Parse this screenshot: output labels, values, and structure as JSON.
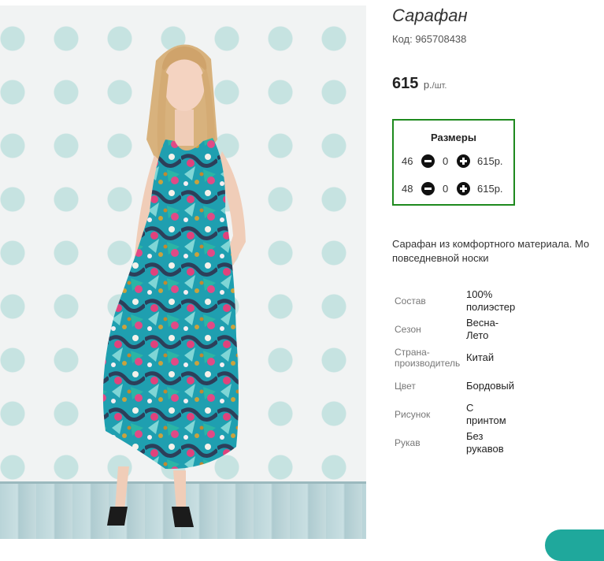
{
  "product": {
    "title": "Сарафан",
    "code": "Код: 965708438",
    "price": {
      "value": "615",
      "unit": "р.",
      "per": "/шт."
    },
    "sizes": {
      "header": "Размеры",
      "rows": [
        {
          "size": "46",
          "qty": "0",
          "price": "615р."
        },
        {
          "size": "48",
          "qty": "0",
          "price": "615р."
        }
      ]
    },
    "description": [
      "Сарафан из комфортного материала. Мо",
      "повседневной носки"
    ],
    "attributes": [
      {
        "key": [
          "Состав"
        ],
        "value": [
          "100%",
          "полиэстер"
        ]
      },
      {
        "key": [
          "Сезон"
        ],
        "value": [
          "Весна-",
          "Лето"
        ]
      },
      {
        "key": [
          "Страна-",
          "производитель"
        ],
        "value": [
          "Китай"
        ]
      },
      {
        "key": [
          "Цвет"
        ],
        "value": [
          "Бордовый"
        ]
      },
      {
        "key": [
          "Рисунок"
        ],
        "value": [
          "С",
          "принтом"
        ]
      },
      {
        "key": [
          "Рукав"
        ],
        "value": [
          "Без",
          "рукавов"
        ]
      }
    ]
  },
  "icons": {
    "minus": "minus-circle-icon",
    "plus": "plus-circle-icon"
  },
  "colors": {
    "sizes_border": "#1e8a1e",
    "accent_button": "#1fa89c"
  }
}
